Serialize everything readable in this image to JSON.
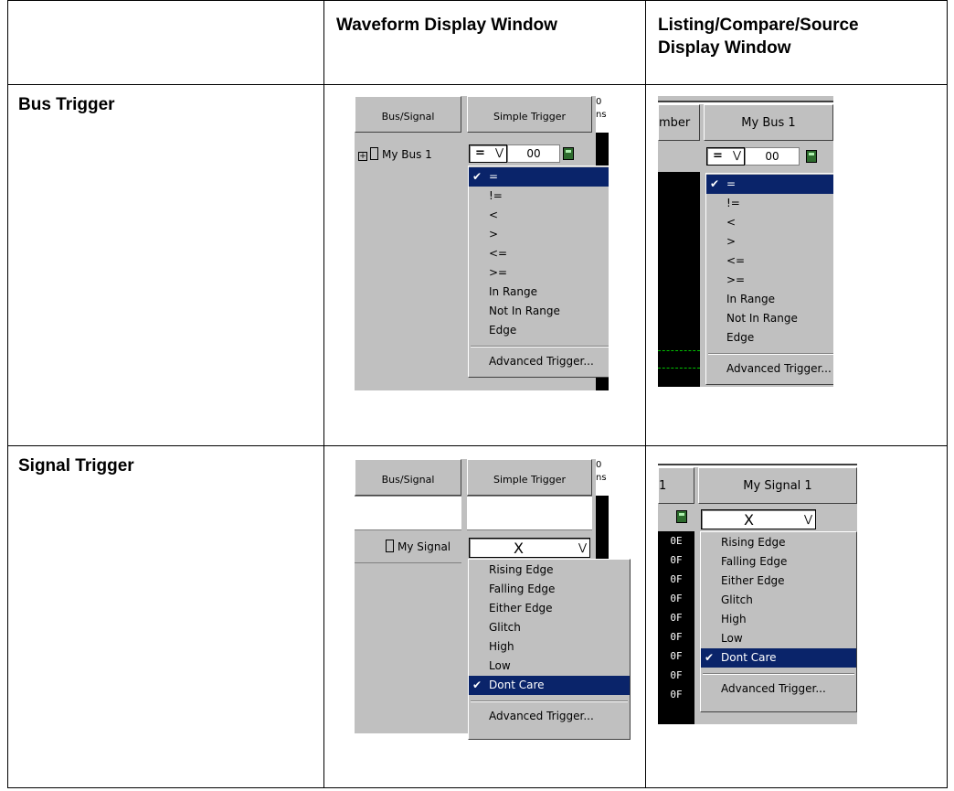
{
  "headers": {
    "col1": "Waveform Display Window",
    "col2": "Listing/Compare/Source Display Window"
  },
  "rows": {
    "bus": "Bus Trigger",
    "signal": "Signal Trigger"
  },
  "bus_waveform": {
    "col_bus_signal": "Bus/Signal",
    "col_simple_trigger": "Simple Trigger",
    "time_label": "0 ns",
    "bus_name": "My Bus 1",
    "operator": "=",
    "value": "00",
    "menu_items": [
      "=",
      "!=",
      "<",
      ">",
      "<=",
      ">=",
      "In Range",
      "Not In Range",
      "Edge"
    ],
    "menu_selected_index": 0,
    "advanced": "Advanced Trigger..."
  },
  "bus_listing": {
    "col_number_partial": "mber",
    "col_bus": "My Bus 1",
    "operator": "=",
    "value": "00",
    "menu_items": [
      "=",
      "!=",
      "<",
      ">",
      "<=",
      ">=",
      "In Range",
      "Not In Range",
      "Edge"
    ],
    "menu_selected_index": 0,
    "advanced": "Advanced Trigger..."
  },
  "signal_waveform": {
    "col_bus_signal": "Bus/Signal",
    "col_simple_trigger": "Simple Trigger",
    "time_label": "0 ns",
    "signal_name": "My Signal",
    "trigger_value": "X",
    "menu_items": [
      "Rising Edge",
      "Falling Edge",
      "Either Edge",
      "Glitch",
      "High",
      "Low",
      "Dont Care"
    ],
    "menu_selected_index": 6,
    "advanced": "Advanced Trigger..."
  },
  "signal_listing": {
    "col_partial": "1",
    "col_signal": "My Signal 1",
    "trigger_value": "X",
    "hex_values": [
      "0E",
      "0F",
      "0F",
      "0F",
      "0F",
      "0F",
      "0F",
      "0F",
      "0F"
    ],
    "menu_items": [
      "Rising Edge",
      "Falling Edge",
      "Either Edge",
      "Glitch",
      "High",
      "Low",
      "Dont Care"
    ],
    "menu_selected_index": 6,
    "advanced": "Advanced Trigger..."
  },
  "colors": {
    "selection": "#0a246a",
    "panel": "#c0c0c0",
    "waveform_bg": "#000000"
  }
}
